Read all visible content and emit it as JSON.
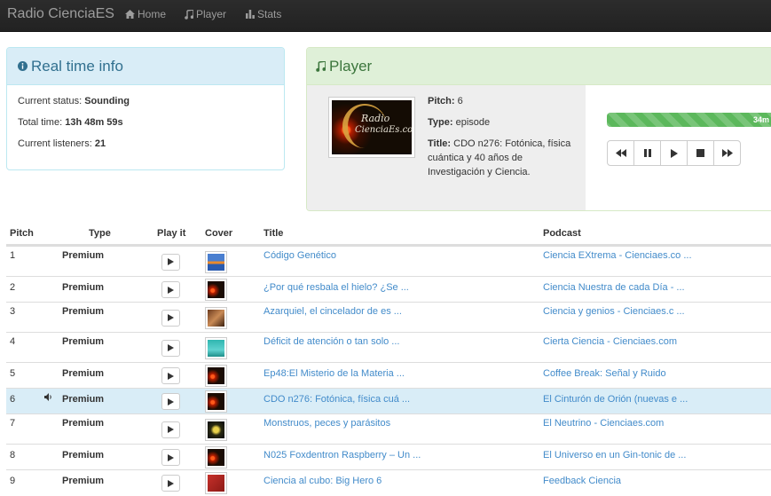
{
  "navbar": {
    "brand": "Radio CienciaES",
    "items": [
      {
        "label": "Home",
        "icon": "home-icon"
      },
      {
        "label": "Player",
        "icon": "music-note-icon"
      },
      {
        "label": "Stats",
        "icon": "bar-chart-icon"
      }
    ]
  },
  "info_panel": {
    "title": "Real time info",
    "icon": "info-circle-icon",
    "status_label": "Current status:",
    "status_value": "Sounding",
    "time_label": "Total time:",
    "time_value": "13h 48m 59s",
    "listeners_label": "Current listeners:",
    "listeners_value": "21"
  },
  "player": {
    "title": "Player",
    "icon": "music-note-icon",
    "cover_text_1": "Radio",
    "cover_text_2": "CienciaEs.com",
    "pitch_label": "Pitch:",
    "pitch_value": "6",
    "type_label": "Type:",
    "type_value": "episode",
    "title_label": "Title:",
    "title_value": "CDO n276: Fotónica, física cuántica y 40 años de Investigación y Ciencia.",
    "progress_text": "34m",
    "progress_fraction": 0.93,
    "controls": [
      "backward-icon",
      "pause-icon",
      "play-icon",
      "stop-icon",
      "forward-icon"
    ],
    "progress_color": "#5cb85c"
  },
  "table": {
    "headers": {
      "pitch": "Pitch",
      "type": "Type",
      "play": "Play it",
      "cover": "Cover",
      "title": "Title",
      "podcast": "Podcast"
    },
    "rows": [
      {
        "pitch": "1",
        "type": "Premium",
        "title": "Código Genético",
        "podcast": "Ciencia EXtrema - Cienciaes.co ...",
        "cover": "extrema"
      },
      {
        "pitch": "2",
        "type": "Premium",
        "title": "¿Por qué resbala el hielo? ¿Se ...",
        "podcast": "Ciencia Nuestra de cada Día - ...",
        "cover": "radio"
      },
      {
        "pitch": "3",
        "type": "Premium",
        "title": "Azarquiel, el cincelador de es ...",
        "podcast": "Ciencia y genios - Cienciaes.c ...",
        "cover": "genios"
      },
      {
        "pitch": "4",
        "type": "Premium",
        "title": "Déficit de atención o tan solo ...",
        "podcast": "Cierta Ciencia - Cienciaes.com",
        "cover": "cierta"
      },
      {
        "pitch": "5",
        "type": "Premium",
        "title": "Ep48:El Misterio de la Materia ...",
        "podcast": "Coffee Break: Señal y Ruido",
        "cover": "radio"
      },
      {
        "pitch": "6",
        "type": "Premium",
        "title": "CDO n276: Fotónica, física cuá ...",
        "podcast": "El Cinturón de Orión (nuevas e ...",
        "cover": "radio",
        "active": true
      },
      {
        "pitch": "7",
        "type": "Premium",
        "title": "Monstruos, peces y parásitos",
        "podcast": "El Neutrino - Cienciaes.com",
        "cover": "neutrino"
      },
      {
        "pitch": "8",
        "type": "Premium",
        "title": "N025 Foxdentron Raspberry – Un ...",
        "podcast": "El Universo en un Gin-tonic de ...",
        "cover": "radio"
      },
      {
        "pitch": "9",
        "type": "Premium",
        "title": "Ciencia al cubo: Big Hero 6",
        "podcast": "Feedback Ciencia",
        "cover": "feedback"
      }
    ]
  }
}
